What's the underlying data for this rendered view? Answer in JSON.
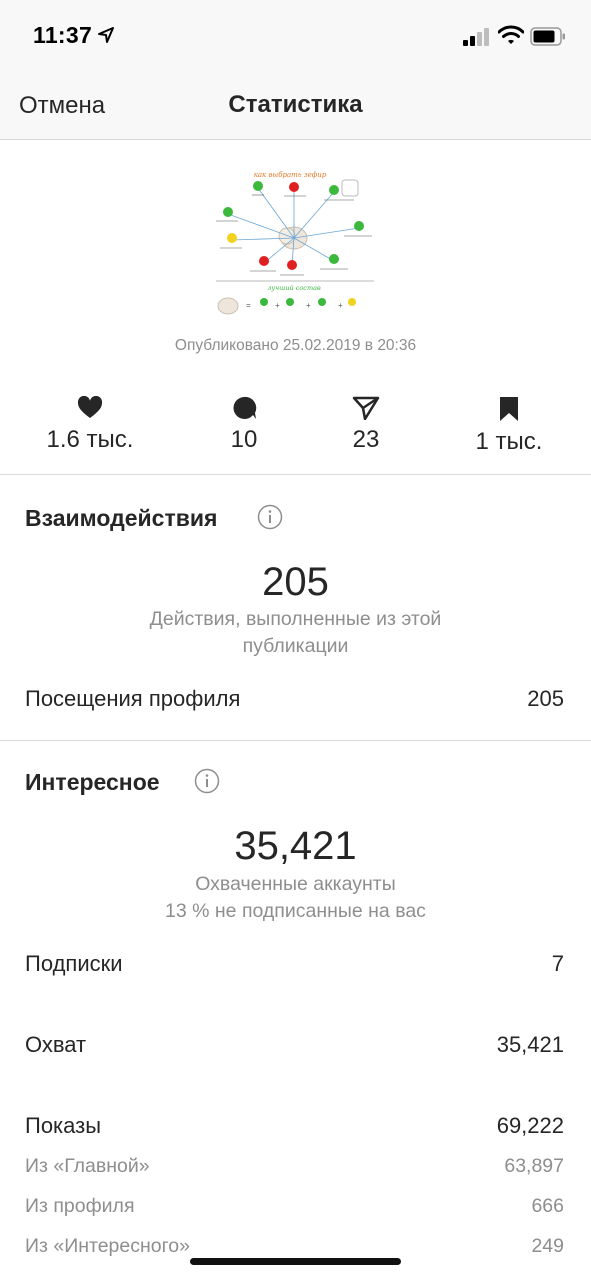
{
  "status_bar": {
    "time": "11:37"
  },
  "nav": {
    "cancel_label": "Отмена",
    "title": "Статистика"
  },
  "post": {
    "thumbnail_title": "как выбрать зефир",
    "thumbnail_subtitle": "лучший состав",
    "published": "Опубликовано 25.02.2019 в 20:36"
  },
  "metrics": [
    {
      "icon": "heart-icon",
      "value": "1.6 тыс."
    },
    {
      "icon": "comment-icon",
      "value": "10"
    },
    {
      "icon": "send-icon",
      "value": "23"
    },
    {
      "icon": "bookmark-icon",
      "value": "1 тыс."
    }
  ],
  "interactions": {
    "title": "Взаимодействия",
    "total": "205",
    "description": "Действия, выполненные из этой публикации",
    "rows": [
      {
        "label": "Посещения профиля",
        "value": "205"
      }
    ]
  },
  "discovery": {
    "title": "Интересное",
    "total": "35,421",
    "description": "Охваченные аккаунты",
    "description2": "13 % не подписанные на вас",
    "rows": [
      {
        "label": "Подписки",
        "value": "7"
      },
      {
        "label": "Охват",
        "value": "35,421"
      },
      {
        "label": "Показы",
        "value": "69,222"
      }
    ],
    "sub_rows": [
      {
        "label": "Из «Главной»",
        "value": "63,897"
      },
      {
        "label": "Из профиля",
        "value": "666"
      },
      {
        "label": "Из «Интересного»",
        "value": "249"
      }
    ]
  },
  "colors": {
    "text": "#262626",
    "muted": "#8e8e8e",
    "divider": "#dbdbdb",
    "bar_bg": "#f8f8f8"
  }
}
